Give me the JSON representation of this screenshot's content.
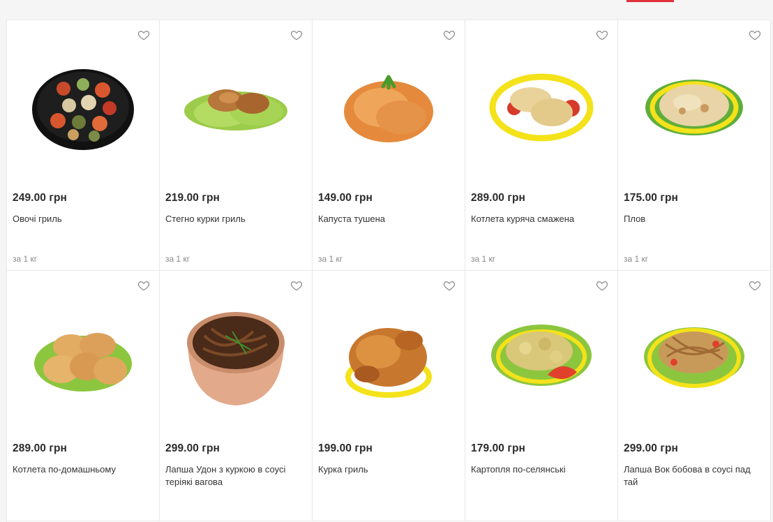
{
  "colors": {
    "accent": "#e0303a"
  },
  "icons": {
    "favorite": "heart-outline-icon"
  },
  "products": [
    {
      "price": "249.00 грн",
      "name": "Овочі гриль",
      "unit": "за 1 кг",
      "image": "grilled-vegetables"
    },
    {
      "price": "219.00 грн",
      "name": "Стегно курки гриль",
      "unit": "за 1 кг",
      "image": "grilled-chicken-thigh"
    },
    {
      "price": "149.00 грн",
      "name": "Капуста тушена",
      "unit": "за 1 кг",
      "image": "stewed-cabbage"
    },
    {
      "price": "289.00 грн",
      "name": "Котлета куряча смажена",
      "unit": "за 1 кг",
      "image": "fried-chicken-cutlet"
    },
    {
      "price": "175.00 грн",
      "name": "Плов",
      "unit": "за 1 кг",
      "image": "pilaf"
    },
    {
      "price": "289.00 грн",
      "name": "Котлета по-домашньому",
      "unit": "",
      "image": "homemade-cutlets"
    },
    {
      "price": "299.00 грн",
      "name": "Лапша Удон з куркою в соусі теріякі вагова",
      "unit": "",
      "image": "udon-noodles-bowl"
    },
    {
      "price": "199.00 грн",
      "name": "Курка гриль",
      "unit": "",
      "image": "grilled-chicken"
    },
    {
      "price": "179.00 грн",
      "name": "Картопля по-селянські",
      "unit": "",
      "image": "country-potatoes"
    },
    {
      "price": "299.00 грн",
      "name": "Лапша Вок бобова в соусі пад тай",
      "unit": "",
      "image": "wok-bean-noodles"
    }
  ]
}
